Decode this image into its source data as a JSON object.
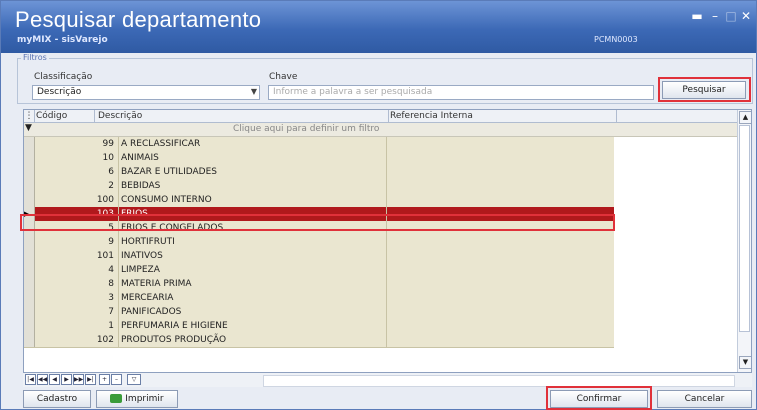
{
  "window": {
    "title": "Pesquisar departamento",
    "subtitle": "myMIX - sisVarejo",
    "code": "PCMN0003",
    "controls": [
      "▬",
      "–",
      "□",
      "✕"
    ]
  },
  "filters": {
    "legend": "Filtros",
    "classification_label": "Classificação",
    "classification_value": "Descrição",
    "key_label": "Chave",
    "key_placeholder": "Informe a palavra a ser pesquisada",
    "search_button": "Pesquisar"
  },
  "grid": {
    "columns": [
      "Código",
      "Descrição",
      "Referencia Interna"
    ],
    "filter_hint": "Clique aqui para definir um filtro",
    "selected_index": 5,
    "rows": [
      {
        "code": "99",
        "description": "A RECLASSIFICAR"
      },
      {
        "code": "10",
        "description": "ANIMAIS"
      },
      {
        "code": "6",
        "description": "BAZAR E UTILIDADES"
      },
      {
        "code": "2",
        "description": "BEBIDAS"
      },
      {
        "code": "100",
        "description": "CONSUMO INTERNO"
      },
      {
        "code": "103",
        "description": "FRIOS"
      },
      {
        "code": "5",
        "description": "FRIOS E CONGELADOS"
      },
      {
        "code": "9",
        "description": "HORTIFRUTI"
      },
      {
        "code": "101",
        "description": "INATIVOS"
      },
      {
        "code": "4",
        "description": "LIMPEZA"
      },
      {
        "code": "8",
        "description": "MATERIA PRIMA"
      },
      {
        "code": "3",
        "description": "MERCEARIA"
      },
      {
        "code": "7",
        "description": "PANIFICADOS"
      },
      {
        "code": "1",
        "description": "PERFUMARIA E HIGIENE"
      },
      {
        "code": "102",
        "description": "PRODUTOS PRODUÇÃO"
      }
    ]
  },
  "navigator": {
    "buttons": [
      "|◀",
      "◀◀",
      "◀",
      "▶",
      "▶▶",
      "▶|",
      "+",
      "–"
    ]
  },
  "footer": {
    "cadastro": "Cadastro",
    "imprimir": "Imprimir",
    "confirmar": "Confirmar",
    "cancelar": "Cancelar"
  },
  "colors": {
    "title_bar": "#3c69b6",
    "selection": "#b0191c",
    "highlight": "#e0313a",
    "row": "#eae6d0"
  }
}
